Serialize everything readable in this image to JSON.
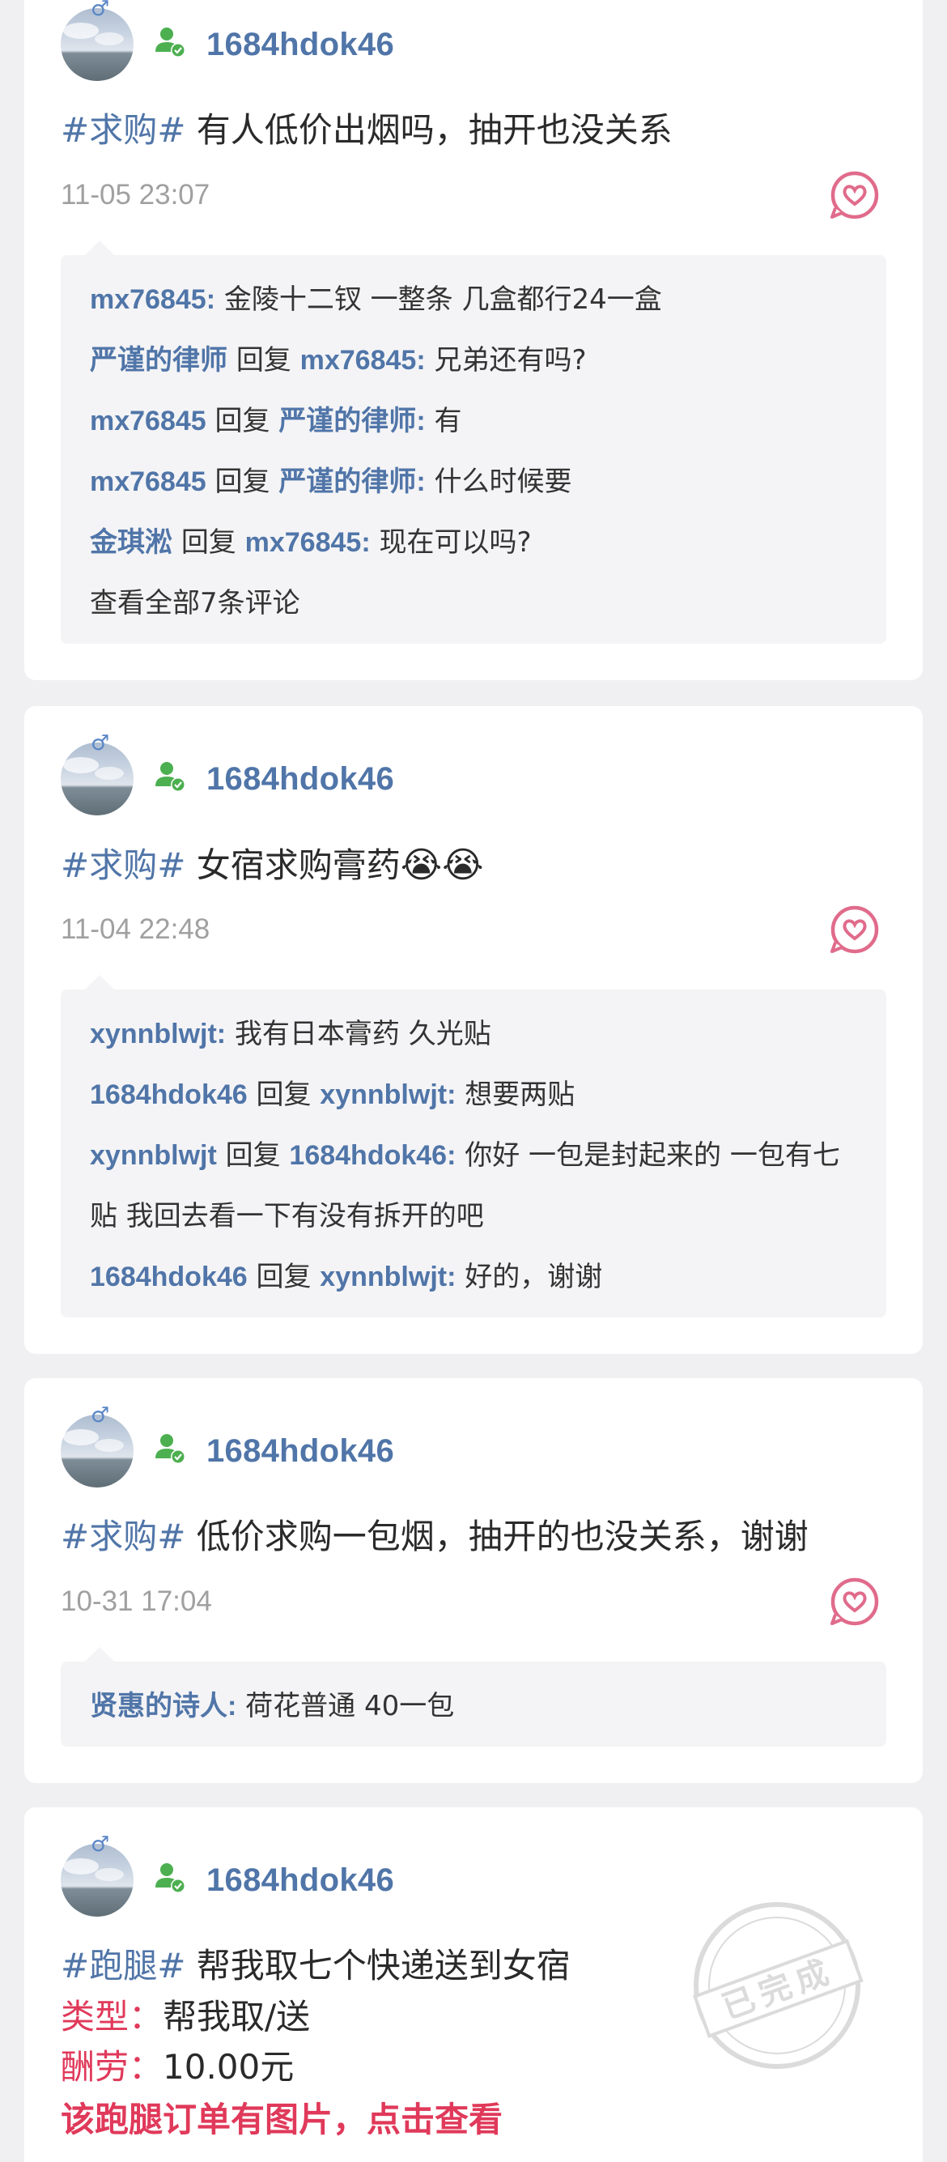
{
  "posts": [
    {
      "username": "1684hdok46",
      "tag": "#求购#",
      "text": "有人低价出烟吗，抽开也没关系",
      "time": "11-05 23:07",
      "comments": [
        {
          "from": "mx76845",
          "reply_word": "",
          "to": "",
          "text": "金陵十二钗 一整条 几盒都行24一盒"
        },
        {
          "from": "严谨的律师",
          "reply_word": "回复",
          "to": "mx76845",
          "text": "兄弟还有吗?"
        },
        {
          "from": "mx76845",
          "reply_word": "回复",
          "to": "严谨的律师",
          "text": "有"
        },
        {
          "from": "mx76845",
          "reply_word": "回复",
          "to": "严谨的律师",
          "text": "什么时候要"
        },
        {
          "from": "金琪淞",
          "reply_word": "回复",
          "to": "mx76845",
          "text": "现在可以吗?"
        }
      ],
      "view_all": "查看全部7条评论"
    },
    {
      "username": "1684hdok46",
      "tag": "#求购#",
      "text": "女宿求购膏药",
      "emoji": "😭😭",
      "time": "11-04 22:48",
      "comments": [
        {
          "from": "xynnblwjt",
          "reply_word": "",
          "to": "",
          "text": "我有日本膏药 久光贴"
        },
        {
          "from": "1684hdok46",
          "reply_word": "回复",
          "to": "xynnblwjt",
          "text": "想要两贴"
        },
        {
          "from": "xynnblwjt",
          "reply_word": "回复",
          "to": "1684hdok46",
          "text": "你好 一包是封起来的 一包有七贴 我回去看一下有没有拆开的吧"
        },
        {
          "from": "1684hdok46",
          "reply_word": "回复",
          "to": "xynnblwjt",
          "text": "好的，谢谢"
        }
      ]
    },
    {
      "username": "1684hdok46",
      "tag": "#求购#",
      "text": "低价求购一包烟，抽开的也没关系，谢谢",
      "time": "10-31 17:04",
      "comments": [
        {
          "from": "贤惠的诗人",
          "reply_word": "",
          "to": "",
          "text": "荷花普通 40一包"
        }
      ]
    },
    {
      "username": "1684hdok46",
      "tag": "#跑腿#",
      "text": "帮我取七个快递送到女宿",
      "type_label": "类型：",
      "type_value": "帮我取/送",
      "fee_label": "酬劳：",
      "fee_value": "10.00元",
      "image_notice": "该跑腿订单有图片，点击查看",
      "stamp_text": "已完成"
    }
  ],
  "colors": {
    "accent": "#5075a8",
    "time": "#a0a0a0",
    "red": "#e0395a",
    "like": "#e06b8b",
    "verify": "#4caf50"
  },
  "icons": {
    "gender": "male-icon",
    "verify": "verified-user-icon",
    "like": "heart-icon"
  }
}
